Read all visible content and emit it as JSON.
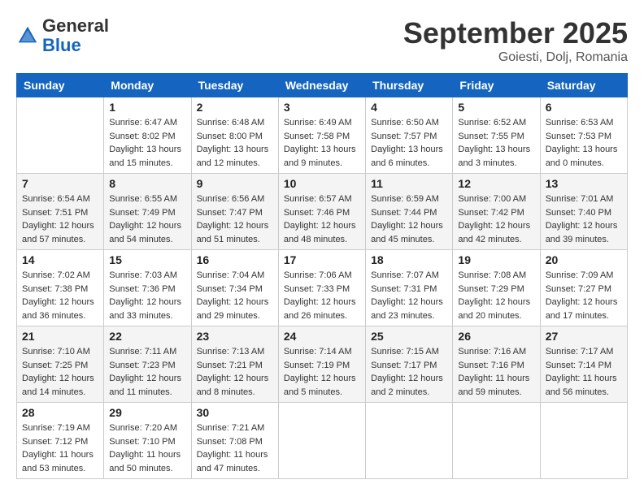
{
  "header": {
    "logo_line1": "General",
    "logo_line2": "Blue",
    "month": "September 2025",
    "location": "Goiesti, Dolj, Romania"
  },
  "weekdays": [
    "Sunday",
    "Monday",
    "Tuesday",
    "Wednesday",
    "Thursday",
    "Friday",
    "Saturday"
  ],
  "weeks": [
    [
      {
        "day": null
      },
      {
        "day": "1",
        "sunrise": "6:47 AM",
        "sunset": "8:02 PM",
        "daylight": "13 hours and 15 minutes."
      },
      {
        "day": "2",
        "sunrise": "6:48 AM",
        "sunset": "8:00 PM",
        "daylight": "13 hours and 12 minutes."
      },
      {
        "day": "3",
        "sunrise": "6:49 AM",
        "sunset": "7:58 PM",
        "daylight": "13 hours and 9 minutes."
      },
      {
        "day": "4",
        "sunrise": "6:50 AM",
        "sunset": "7:57 PM",
        "daylight": "13 hours and 6 minutes."
      },
      {
        "day": "5",
        "sunrise": "6:52 AM",
        "sunset": "7:55 PM",
        "daylight": "13 hours and 3 minutes."
      },
      {
        "day": "6",
        "sunrise": "6:53 AM",
        "sunset": "7:53 PM",
        "daylight": "13 hours and 0 minutes."
      }
    ],
    [
      {
        "day": "7",
        "sunrise": "6:54 AM",
        "sunset": "7:51 PM",
        "daylight": "12 hours and 57 minutes."
      },
      {
        "day": "8",
        "sunrise": "6:55 AM",
        "sunset": "7:49 PM",
        "daylight": "12 hours and 54 minutes."
      },
      {
        "day": "9",
        "sunrise": "6:56 AM",
        "sunset": "7:47 PM",
        "daylight": "12 hours and 51 minutes."
      },
      {
        "day": "10",
        "sunrise": "6:57 AM",
        "sunset": "7:46 PM",
        "daylight": "12 hours and 48 minutes."
      },
      {
        "day": "11",
        "sunrise": "6:59 AM",
        "sunset": "7:44 PM",
        "daylight": "12 hours and 45 minutes."
      },
      {
        "day": "12",
        "sunrise": "7:00 AM",
        "sunset": "7:42 PM",
        "daylight": "12 hours and 42 minutes."
      },
      {
        "day": "13",
        "sunrise": "7:01 AM",
        "sunset": "7:40 PM",
        "daylight": "12 hours and 39 minutes."
      }
    ],
    [
      {
        "day": "14",
        "sunrise": "7:02 AM",
        "sunset": "7:38 PM",
        "daylight": "12 hours and 36 minutes."
      },
      {
        "day": "15",
        "sunrise": "7:03 AM",
        "sunset": "7:36 PM",
        "daylight": "12 hours and 33 minutes."
      },
      {
        "day": "16",
        "sunrise": "7:04 AM",
        "sunset": "7:34 PM",
        "daylight": "12 hours and 29 minutes."
      },
      {
        "day": "17",
        "sunrise": "7:06 AM",
        "sunset": "7:33 PM",
        "daylight": "12 hours and 26 minutes."
      },
      {
        "day": "18",
        "sunrise": "7:07 AM",
        "sunset": "7:31 PM",
        "daylight": "12 hours and 23 minutes."
      },
      {
        "day": "19",
        "sunrise": "7:08 AM",
        "sunset": "7:29 PM",
        "daylight": "12 hours and 20 minutes."
      },
      {
        "day": "20",
        "sunrise": "7:09 AM",
        "sunset": "7:27 PM",
        "daylight": "12 hours and 17 minutes."
      }
    ],
    [
      {
        "day": "21",
        "sunrise": "7:10 AM",
        "sunset": "7:25 PM",
        "daylight": "12 hours and 14 minutes."
      },
      {
        "day": "22",
        "sunrise": "7:11 AM",
        "sunset": "7:23 PM",
        "daylight": "12 hours and 11 minutes."
      },
      {
        "day": "23",
        "sunrise": "7:13 AM",
        "sunset": "7:21 PM",
        "daylight": "12 hours and 8 minutes."
      },
      {
        "day": "24",
        "sunrise": "7:14 AM",
        "sunset": "7:19 PM",
        "daylight": "12 hours and 5 minutes."
      },
      {
        "day": "25",
        "sunrise": "7:15 AM",
        "sunset": "7:17 PM",
        "daylight": "12 hours and 2 minutes."
      },
      {
        "day": "26",
        "sunrise": "7:16 AM",
        "sunset": "7:16 PM",
        "daylight": "11 hours and 59 minutes."
      },
      {
        "day": "27",
        "sunrise": "7:17 AM",
        "sunset": "7:14 PM",
        "daylight": "11 hours and 56 minutes."
      }
    ],
    [
      {
        "day": "28",
        "sunrise": "7:19 AM",
        "sunset": "7:12 PM",
        "daylight": "11 hours and 53 minutes."
      },
      {
        "day": "29",
        "sunrise": "7:20 AM",
        "sunset": "7:10 PM",
        "daylight": "11 hours and 50 minutes."
      },
      {
        "day": "30",
        "sunrise": "7:21 AM",
        "sunset": "7:08 PM",
        "daylight": "11 hours and 47 minutes."
      },
      {
        "day": null
      },
      {
        "day": null
      },
      {
        "day": null
      },
      {
        "day": null
      }
    ]
  ]
}
